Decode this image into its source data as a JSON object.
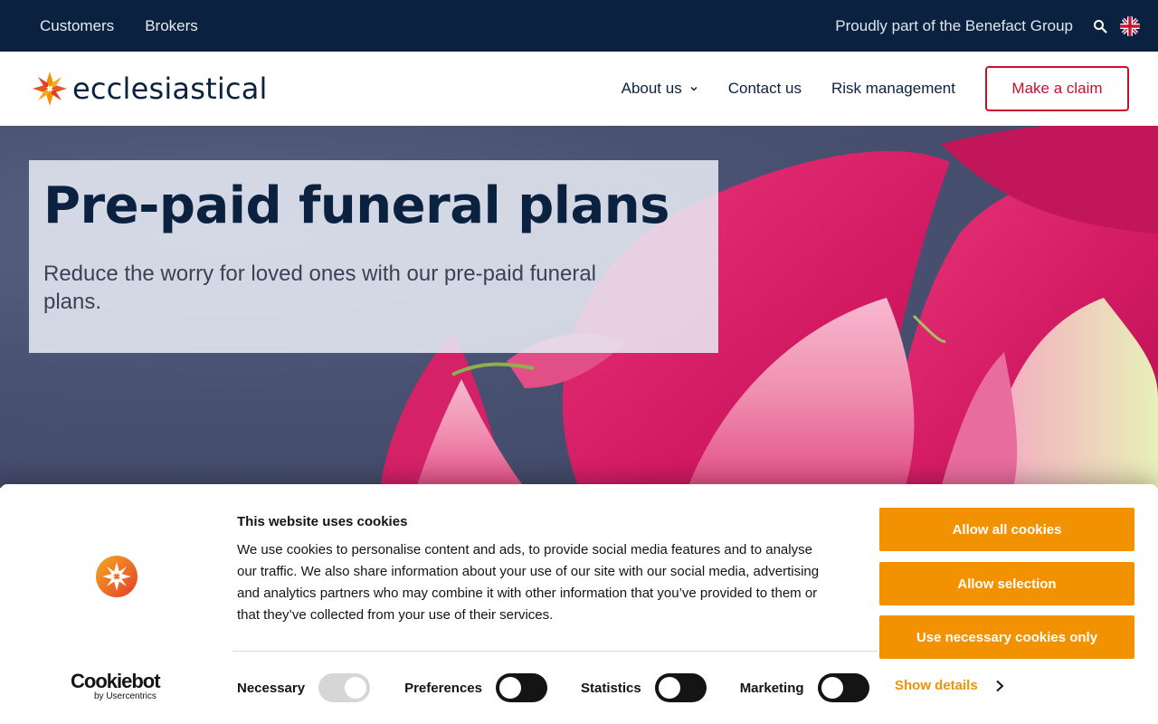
{
  "topbar": {
    "links": [
      "Customers",
      "Brokers"
    ],
    "group_text": "Proudly part of the Benefact Group",
    "search_icon": "search-icon",
    "flag_icon": "uk-flag-icon"
  },
  "header": {
    "logo_text": "ecclesiastical",
    "nav": {
      "about": "About us",
      "contact": "Contact us",
      "risk": "Risk management"
    },
    "claim_button": "Make a claim"
  },
  "hero": {
    "title": "Pre-paid funeral plans",
    "subtitle": "Reduce the worry for loved ones with our pre-paid funeral plans."
  },
  "cookie_banner": {
    "title": "This website uses cookies",
    "body": "We use cookies to personalise content and ads, to provide social media features and to analyse our traffic. We also share information about your use of our site with our social media, advertising and analytics partners who may combine it with other information that you’ve provided to them or that they’ve collected from your use of their services.",
    "buttons": {
      "allow_all": "Allow all cookies",
      "allow_selection": "Allow selection",
      "necessary_only": "Use necessary cookies only"
    },
    "toggles": {
      "necessary": "Necessary",
      "preferences": "Preferences",
      "statistics": "Statistics",
      "marketing": "Marketing"
    },
    "show_details": "Show details",
    "brand_big": "Cookiebot",
    "brand_small": "by Usercentrics"
  },
  "colors": {
    "navy": "#0a2240",
    "claim_red": "#c8102e",
    "cookie_orange": "#f39200"
  }
}
